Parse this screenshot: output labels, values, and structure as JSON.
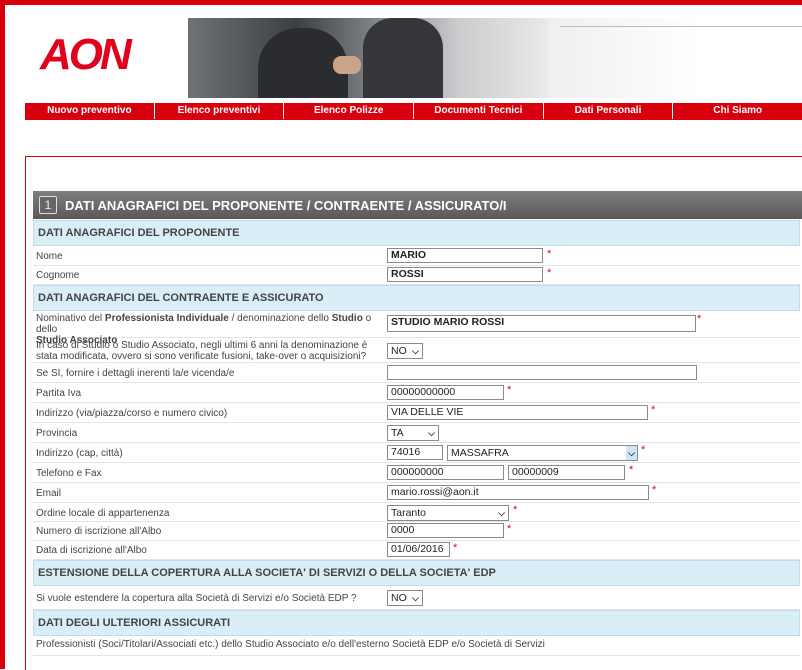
{
  "brand": {
    "logo_text": "AON"
  },
  "nav": [
    "Nuovo preventivo",
    "Elenco preventivi",
    "Elenco Polizze",
    "Documenti Tecnici",
    "Dati Personali",
    "Chi Siamo"
  ],
  "section": {
    "number": "1",
    "title": "DATI ANAGRAFICI DEL PROPONENTE / CONTRAENTE / ASSICURATO/I"
  },
  "subheads": {
    "proponente": "DATI ANAGRAFICI DEL PROPONENTE",
    "contraente": "DATI ANAGRAFICI DEL CONTRAENTE E ASSICURATO",
    "estensione": "ESTENSIONE DELLA COPERTURA ALLA SOCIETA' DI SERVIZI O DELLA SOCIETA' EDP",
    "ulteriori": "DATI DEGLI ULTERIORI ASSICURATI"
  },
  "labels": {
    "nome": "Nome",
    "cognome": "Cognome",
    "nominativo_1": "Nominativo del ",
    "nominativo_b1": "Professionista Individuale",
    "nominativo_2": " / denominazione dello ",
    "nominativo_b2": "Studio",
    "nominativo_3": " o dello",
    "nominativo_b3": "Studio Associato",
    "caso_studio": "In caso di Studio o Studio Associato, negli ultimi 6 anni la denominazione è stata modificata, ovvero si sono verificate fusioni, take-over o acquisizioni?",
    "se_si": "Se SI, fornire i dettagli inerenti la/e vicenda/e",
    "partita_iva": "Partita Iva",
    "indirizzo": "Indirizzo (via/piazza/corso e numero civico)",
    "provincia": "Provincia",
    "indirizzo_cap": "Indirizzo (cap, città)",
    "telefono": "Telefono e Fax",
    "email": "Email",
    "ordine": "Ordine locale di appartenenza",
    "numero_albo": "Numero di iscrizione all'Albo",
    "data_albo": "Data di iscrizione all'Albo",
    "estendere": "Si vuole estendere la copertura alla Società di Servizi e/o Società EDP ?",
    "ulteriori_text": "Professionisti (Soci/Titolari/Associati etc.) dello Studio Associato e/o dell'esterno Società EDP e/o Società di Servizi"
  },
  "values": {
    "nome": "MARIO",
    "cognome": "ROSSI",
    "nominativo": "STUDIO MARIO ROSSI",
    "caso_studio": "NO",
    "se_si": "",
    "partita_iva": "00000000000",
    "indirizzo": "VIA DELLE VIE",
    "provincia": "TA",
    "cap": "74016",
    "citta": "MASSAFRA",
    "telefono": "000000000",
    "fax": "00000009",
    "email": "mario.rossi@aon.it",
    "ordine": "Taranto",
    "numero_albo": "0000",
    "data_albo": "01/06/2016",
    "estendere": "NO"
  },
  "required_mark": "*",
  "colors": {
    "brand_red": "#d9000d",
    "subhead_bg": "#d9eef6",
    "section_bg": "#666666"
  }
}
